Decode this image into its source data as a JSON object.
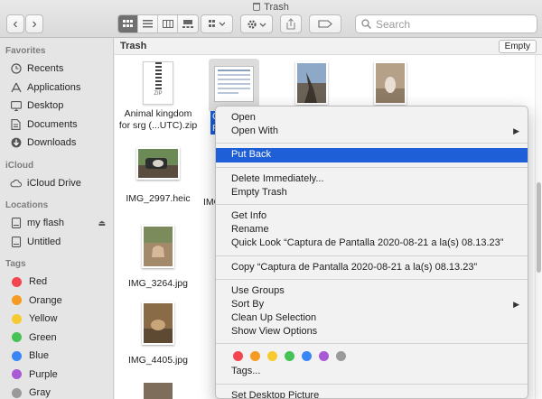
{
  "window": {
    "title": "Trash"
  },
  "toolbar": {
    "back_glyph": "‹",
    "forward_glyph": "›",
    "search_placeholder": "Search",
    "icons": [
      "chevron-left-icon",
      "chevron-right-icon",
      "icon-view-icon",
      "list-view-icon",
      "column-view-icon",
      "gallery-view-icon",
      "group-icon",
      "gear-icon",
      "share-icon",
      "tag-icon",
      "search-icon"
    ]
  },
  "sidebar": {
    "favorites_header": "Favorites",
    "favorites": [
      {
        "label": "Recents",
        "icon": "clock-icon"
      },
      {
        "label": "Applications",
        "icon": "applications-icon"
      },
      {
        "label": "Desktop",
        "icon": "desktop-icon"
      },
      {
        "label": "Documents",
        "icon": "documents-icon"
      },
      {
        "label": "Downloads",
        "icon": "downloads-icon"
      }
    ],
    "icloud_header": "iCloud",
    "icloud": [
      {
        "label": "iCloud Drive",
        "icon": "cloud-icon"
      }
    ],
    "locations_header": "Locations",
    "locations": [
      {
        "label": "my flash",
        "icon": "drive-icon"
      },
      {
        "label": "Untitled",
        "icon": "drive-icon"
      }
    ],
    "tags_header": "Tags",
    "tags": [
      {
        "label": "Red",
        "color": "#f2454f"
      },
      {
        "label": "Orange",
        "color": "#f59a23"
      },
      {
        "label": "Yellow",
        "color": "#f7cb2f"
      },
      {
        "label": "Green",
        "color": "#46c354"
      },
      {
        "label": "Blue",
        "color": "#3b86f6"
      },
      {
        "label": "Purple",
        "color": "#aa5ad4"
      },
      {
        "label": "Gray",
        "color": "#9a9a9a"
      }
    ]
  },
  "main": {
    "path_title": "Trash",
    "empty_label": "Empty",
    "files": {
      "zip_badge": "ZIP",
      "zip_name_line1": "Animal kingdom",
      "zip_name_line2": "for srg (...UTC).zip",
      "shot_name_line1_visible": "C",
      "shot_name_line2_visible": "Pant",
      "img_2997": "IMG_2997.heic",
      "img_2997_partial": "IMG",
      "img_3264": "IMG_3264.jpg",
      "img_4405": "IMG_4405.jpg"
    }
  },
  "context_menu": {
    "open": "Open",
    "open_with": "Open With",
    "put_back": "Put Back",
    "delete_immediately": "Delete Immediately...",
    "empty_trash": "Empty Trash",
    "get_info": "Get Info",
    "rename": "Rename",
    "quick_look": "Quick Look “Captura de Pantalla 2020-08-21 a la(s) 08.13.23”",
    "copy": "Copy “Captura de Pantalla 2020-08-21 a la(s) 08.13.23”",
    "use_groups": "Use Groups",
    "sort_by": "Sort By",
    "clean_up": "Clean Up Selection",
    "view_options": "Show View Options",
    "tag_colors": [
      "#f2454f",
      "#f59a23",
      "#f7cb2f",
      "#46c354",
      "#3b86f6",
      "#aa5ad4",
      "#9a9a9a"
    ],
    "tags": "Tags...",
    "set_desktop": "Set Desktop Picture",
    "submenu_arrow": "▶"
  }
}
